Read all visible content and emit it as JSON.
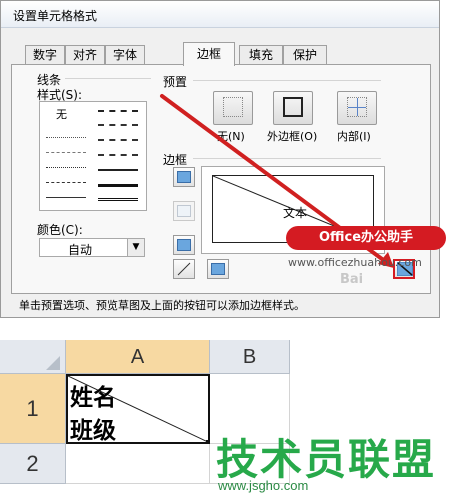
{
  "dialog": {
    "title": "设置单元格格式",
    "tabs": [
      "数字",
      "对齐",
      "字体",
      "边框",
      "填充",
      "保护"
    ],
    "active_tab": "边框"
  },
  "line": {
    "group_label": "线条",
    "style_label": "样式(S):",
    "none_label": "无",
    "color_label": "颜色(C):",
    "color_value": "自动"
  },
  "presets": {
    "group_label": "预置",
    "none": "无(N)",
    "outline": "外边框(O)",
    "inside": "内部(I)"
  },
  "border": {
    "group_label": "边框",
    "preview_text": "文本"
  },
  "hint": "单击预置选项、预览草图及上面的按钮可以添加边框样式。",
  "watermarks": {
    "badge": "Office办公助手",
    "url": "www.officezhuahou.com",
    "baidu": "Bai",
    "brand": "技术员联盟",
    "brand_url": "www.jsgho.com"
  },
  "sheet": {
    "col_a": "A",
    "col_b": "B",
    "row_1": "1",
    "row_2": "2",
    "cell_line1": "姓名",
    "cell_line2": "班级"
  },
  "colors": {
    "accent_red": "#d41b22",
    "arrow_red": "#d02020",
    "selection_blue": "#6aa6de",
    "brand_green": "#27a94a"
  }
}
